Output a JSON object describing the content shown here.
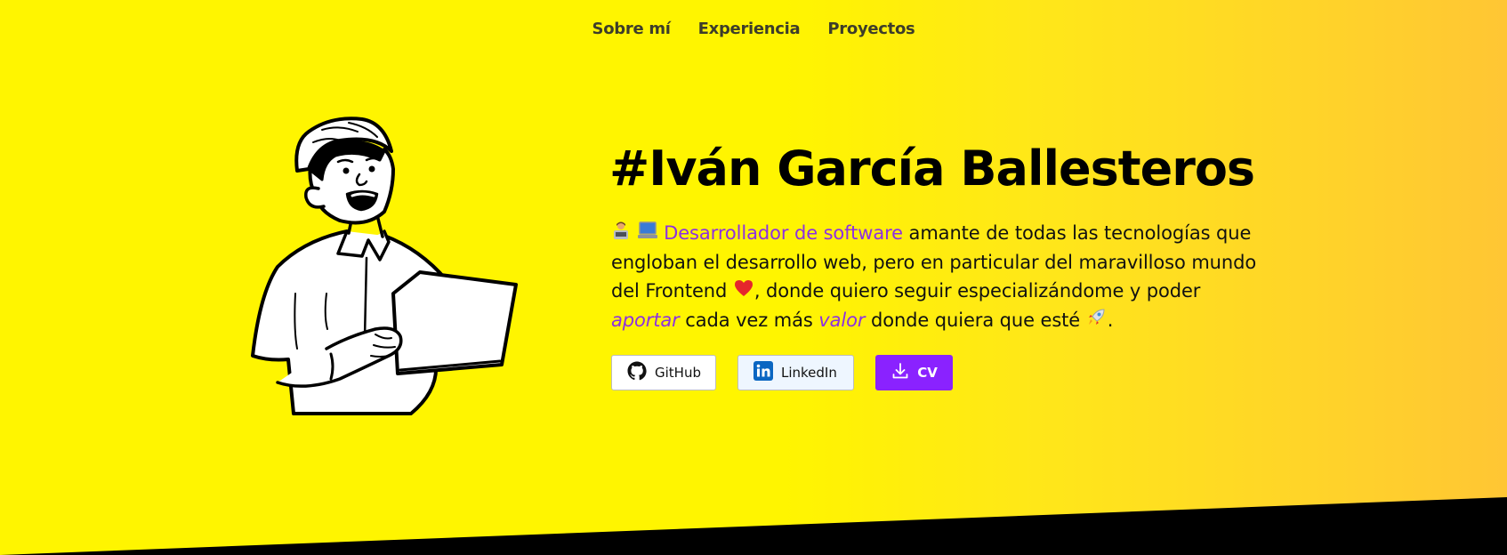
{
  "nav": {
    "items": [
      "Sobre mí",
      "Experiencia",
      "Proyectos"
    ]
  },
  "hero": {
    "title": "#Iván García Ballesteros",
    "desc": {
      "role": "Desarrollador de software",
      "p1": " amante de todas las tecnologías que engloban el desarrollo web, pero en particular del maravilloso mundo del Frontend ",
      "p2": ", donde quiero seguir especializándome y poder ",
      "aportar": "aportar",
      "p3": " cada vez más ",
      "valor": "valor",
      "p4": " donde quiera que esté ",
      "end": "."
    },
    "icons": [
      "technologist-icon",
      "laptop-icon",
      "heart-icon",
      "rocket-icon"
    ]
  },
  "buttons": {
    "github": "GitHub",
    "linkedin": "LinkedIn",
    "cv": "CV"
  },
  "colors": {
    "background": "#fff500",
    "accent": "#8d30e3",
    "cv_button": "#8a22ff",
    "linkedin_blue": "#0a66c2"
  }
}
